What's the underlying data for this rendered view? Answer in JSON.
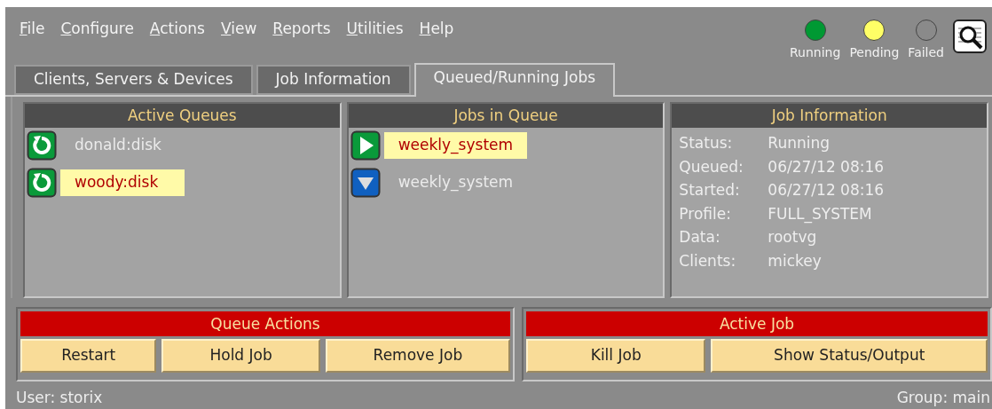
{
  "menu": [
    "File",
    "Configure",
    "Actions",
    "View",
    "Reports",
    "Utilities",
    "Help"
  ],
  "indicators": [
    {
      "label": "Running",
      "color": "#009933"
    },
    {
      "label": "Pending",
      "color": "#ffff66"
    },
    {
      "label": "Failed",
      "color": "#8a8a8a"
    }
  ],
  "tabs": [
    {
      "label": "Clients, Servers & Devices",
      "selected": false
    },
    {
      "label": "Job Information",
      "selected": false
    },
    {
      "label": "Queued/Running Jobs",
      "selected": true
    }
  ],
  "active_queues": {
    "title": "Active Queues",
    "items": [
      {
        "name": "donald:disk",
        "kind": "restart",
        "selected": false
      },
      {
        "name": "woody:disk",
        "kind": "restart",
        "selected": true
      }
    ]
  },
  "jobs_in_queue": {
    "title": "Jobs in Queue",
    "items": [
      {
        "name": "weekly_system",
        "kind": "running",
        "selected": true
      },
      {
        "name": "weekly_system",
        "kind": "queued",
        "selected": false
      }
    ]
  },
  "job_information": {
    "title": "Job Information",
    "fields": [
      {
        "label": "Status:",
        "value": "Running"
      },
      {
        "label": "Queued:",
        "value": "06/27/12 08:16"
      },
      {
        "label": "Started:",
        "value": "06/27/12 08:16"
      },
      {
        "label": "Profile:",
        "value": "FULL_SYSTEM"
      },
      {
        "label": "Data:",
        "value": "rootvg"
      },
      {
        "label": "Clients:",
        "value": "mickey"
      }
    ]
  },
  "queue_actions": {
    "title": "Queue Actions",
    "buttons": [
      "Restart",
      "Hold Job",
      "Remove Job"
    ]
  },
  "active_job": {
    "title": "Active Job",
    "buttons": [
      "Kill Job",
      "Show Status/Output"
    ]
  },
  "status_bar": {
    "user": "User:  storix",
    "group": "Group: main"
  }
}
